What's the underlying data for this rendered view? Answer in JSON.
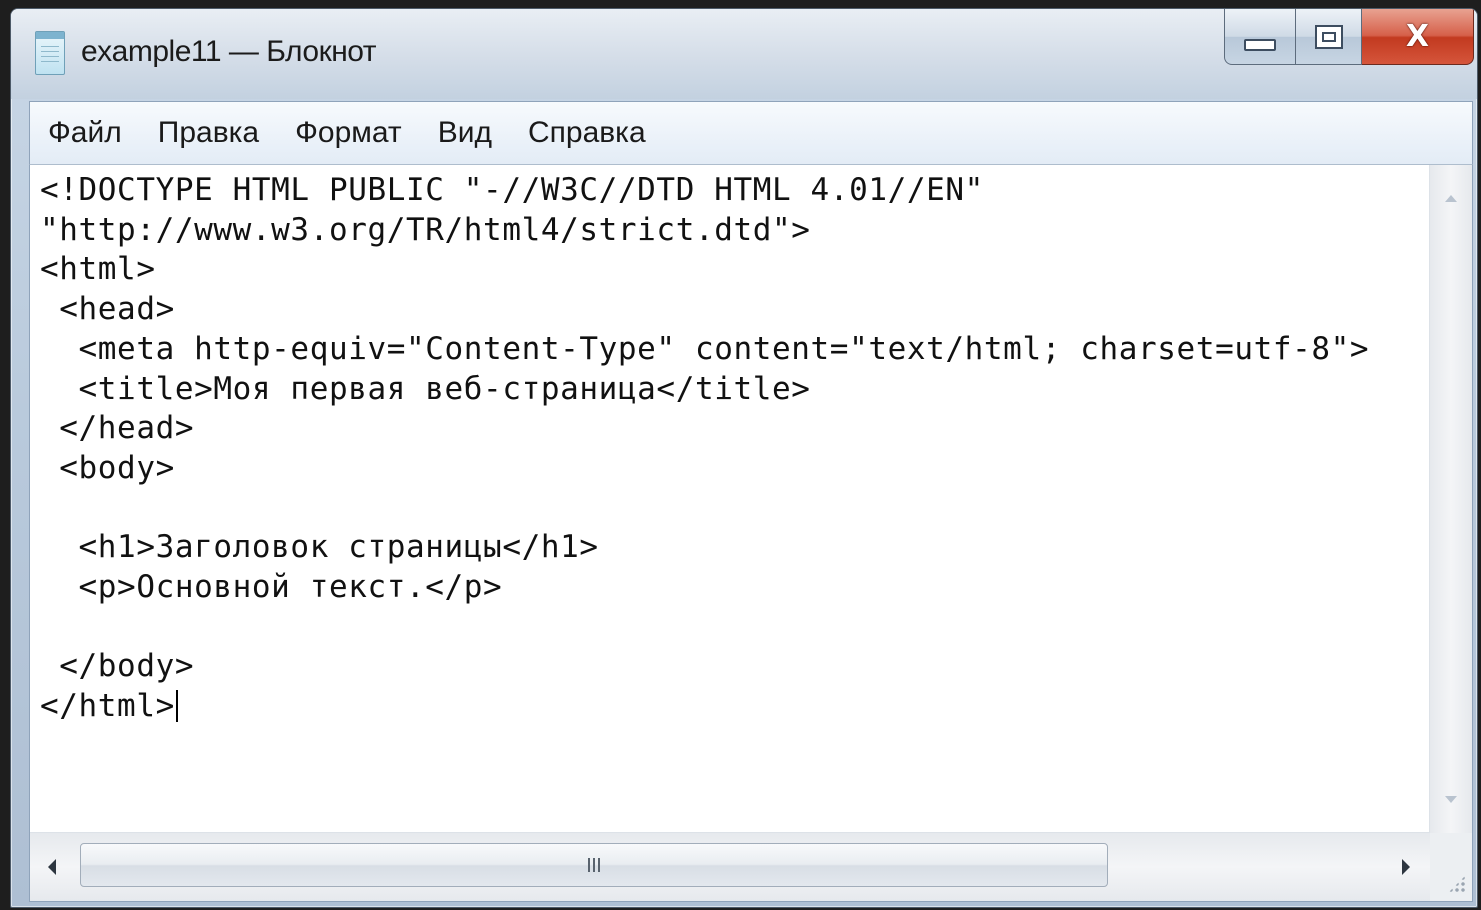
{
  "window": {
    "title": "example11 — Блокнот",
    "app_icon": "notepad-icon",
    "caption_buttons": {
      "minimize_icon": "minimize-icon",
      "maximize_icon": "maximize-icon",
      "close_glyph": "X"
    }
  },
  "menu": {
    "items": [
      {
        "label": "Файл"
      },
      {
        "label": "Правка"
      },
      {
        "label": "Формат"
      },
      {
        "label": "Вид"
      },
      {
        "label": "Справка"
      }
    ]
  },
  "editor": {
    "content": "<!DOCTYPE HTML PUBLIC \"-//W3C//DTD HTML 4.01//EN\"\n\"http://www.w3.org/TR/html4/strict.dtd\">\n<html>\n <head>\n  <meta http-equiv=\"Content-Type\" content=\"text/html; charset=utf-8\">\n  <title>Моя первая веб-страница</title>\n </head>\n <body>\n\n  <h1>Заголовок страницы</h1>\n  <p>Основной текст.</p>\n\n </body>\n</html>"
  },
  "colors": {
    "close_button": "#c23a20",
    "window_frame": "#b9cadc",
    "menubar": "#e3ecf6"
  }
}
